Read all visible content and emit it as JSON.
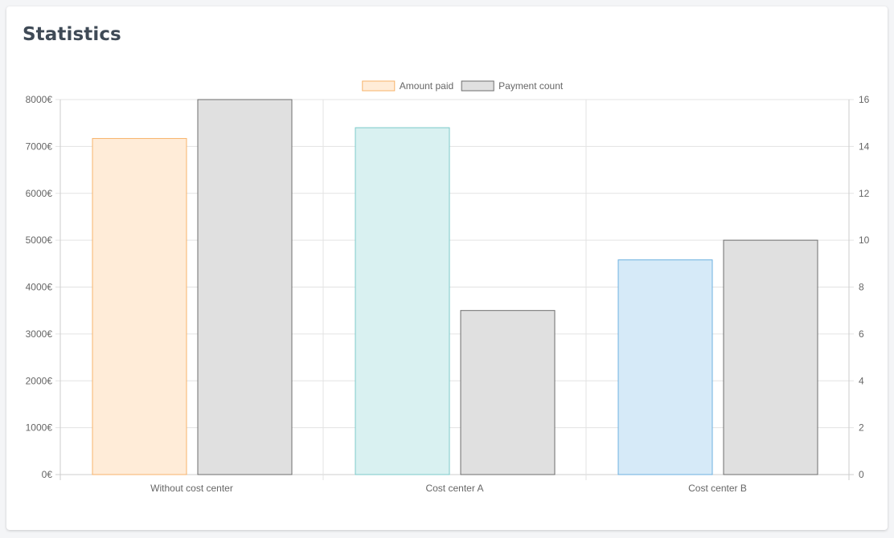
{
  "card": {
    "title": "Statistics"
  },
  "chart_data": {
    "type": "bar",
    "categories": [
      "Without cost center",
      "Cost center A",
      "Cost center B"
    ],
    "series": [
      {
        "name": "Amount paid",
        "axis": "left",
        "values": [
          7170,
          7400,
          4580
        ],
        "fills": [
          "#ffecd8",
          "#d9f1f1",
          "#d6eaf8"
        ],
        "strokes": [
          "#f7b36b",
          "#7ccaca",
          "#6cb0e0"
        ],
        "legend_fill": "#ffecd8",
        "legend_stroke": "#f7b36b"
      },
      {
        "name": "Payment count",
        "axis": "right",
        "values": [
          16,
          7,
          10
        ],
        "fills": [
          "#e0e0e0",
          "#e0e0e0",
          "#e0e0e0"
        ],
        "strokes": [
          "#6e6e6e",
          "#6e6e6e",
          "#6e6e6e"
        ],
        "legend_fill": "#e0e0e0",
        "legend_stroke": "#6e6e6e"
      }
    ],
    "y_left": {
      "ylim": [
        0,
        8000
      ],
      "ticks": [
        0,
        1000,
        2000,
        3000,
        4000,
        5000,
        6000,
        7000,
        8000
      ],
      "tick_suffix": "€"
    },
    "y_right": {
      "ylim": [
        0,
        16
      ],
      "ticks": [
        0,
        2,
        4,
        6,
        8,
        10,
        12,
        14,
        16
      ]
    },
    "grid": true,
    "legend_position": "top-center",
    "colors": {
      "grid": "#e3e3e3",
      "axis": "#cccccc",
      "text": "#666666"
    }
  }
}
